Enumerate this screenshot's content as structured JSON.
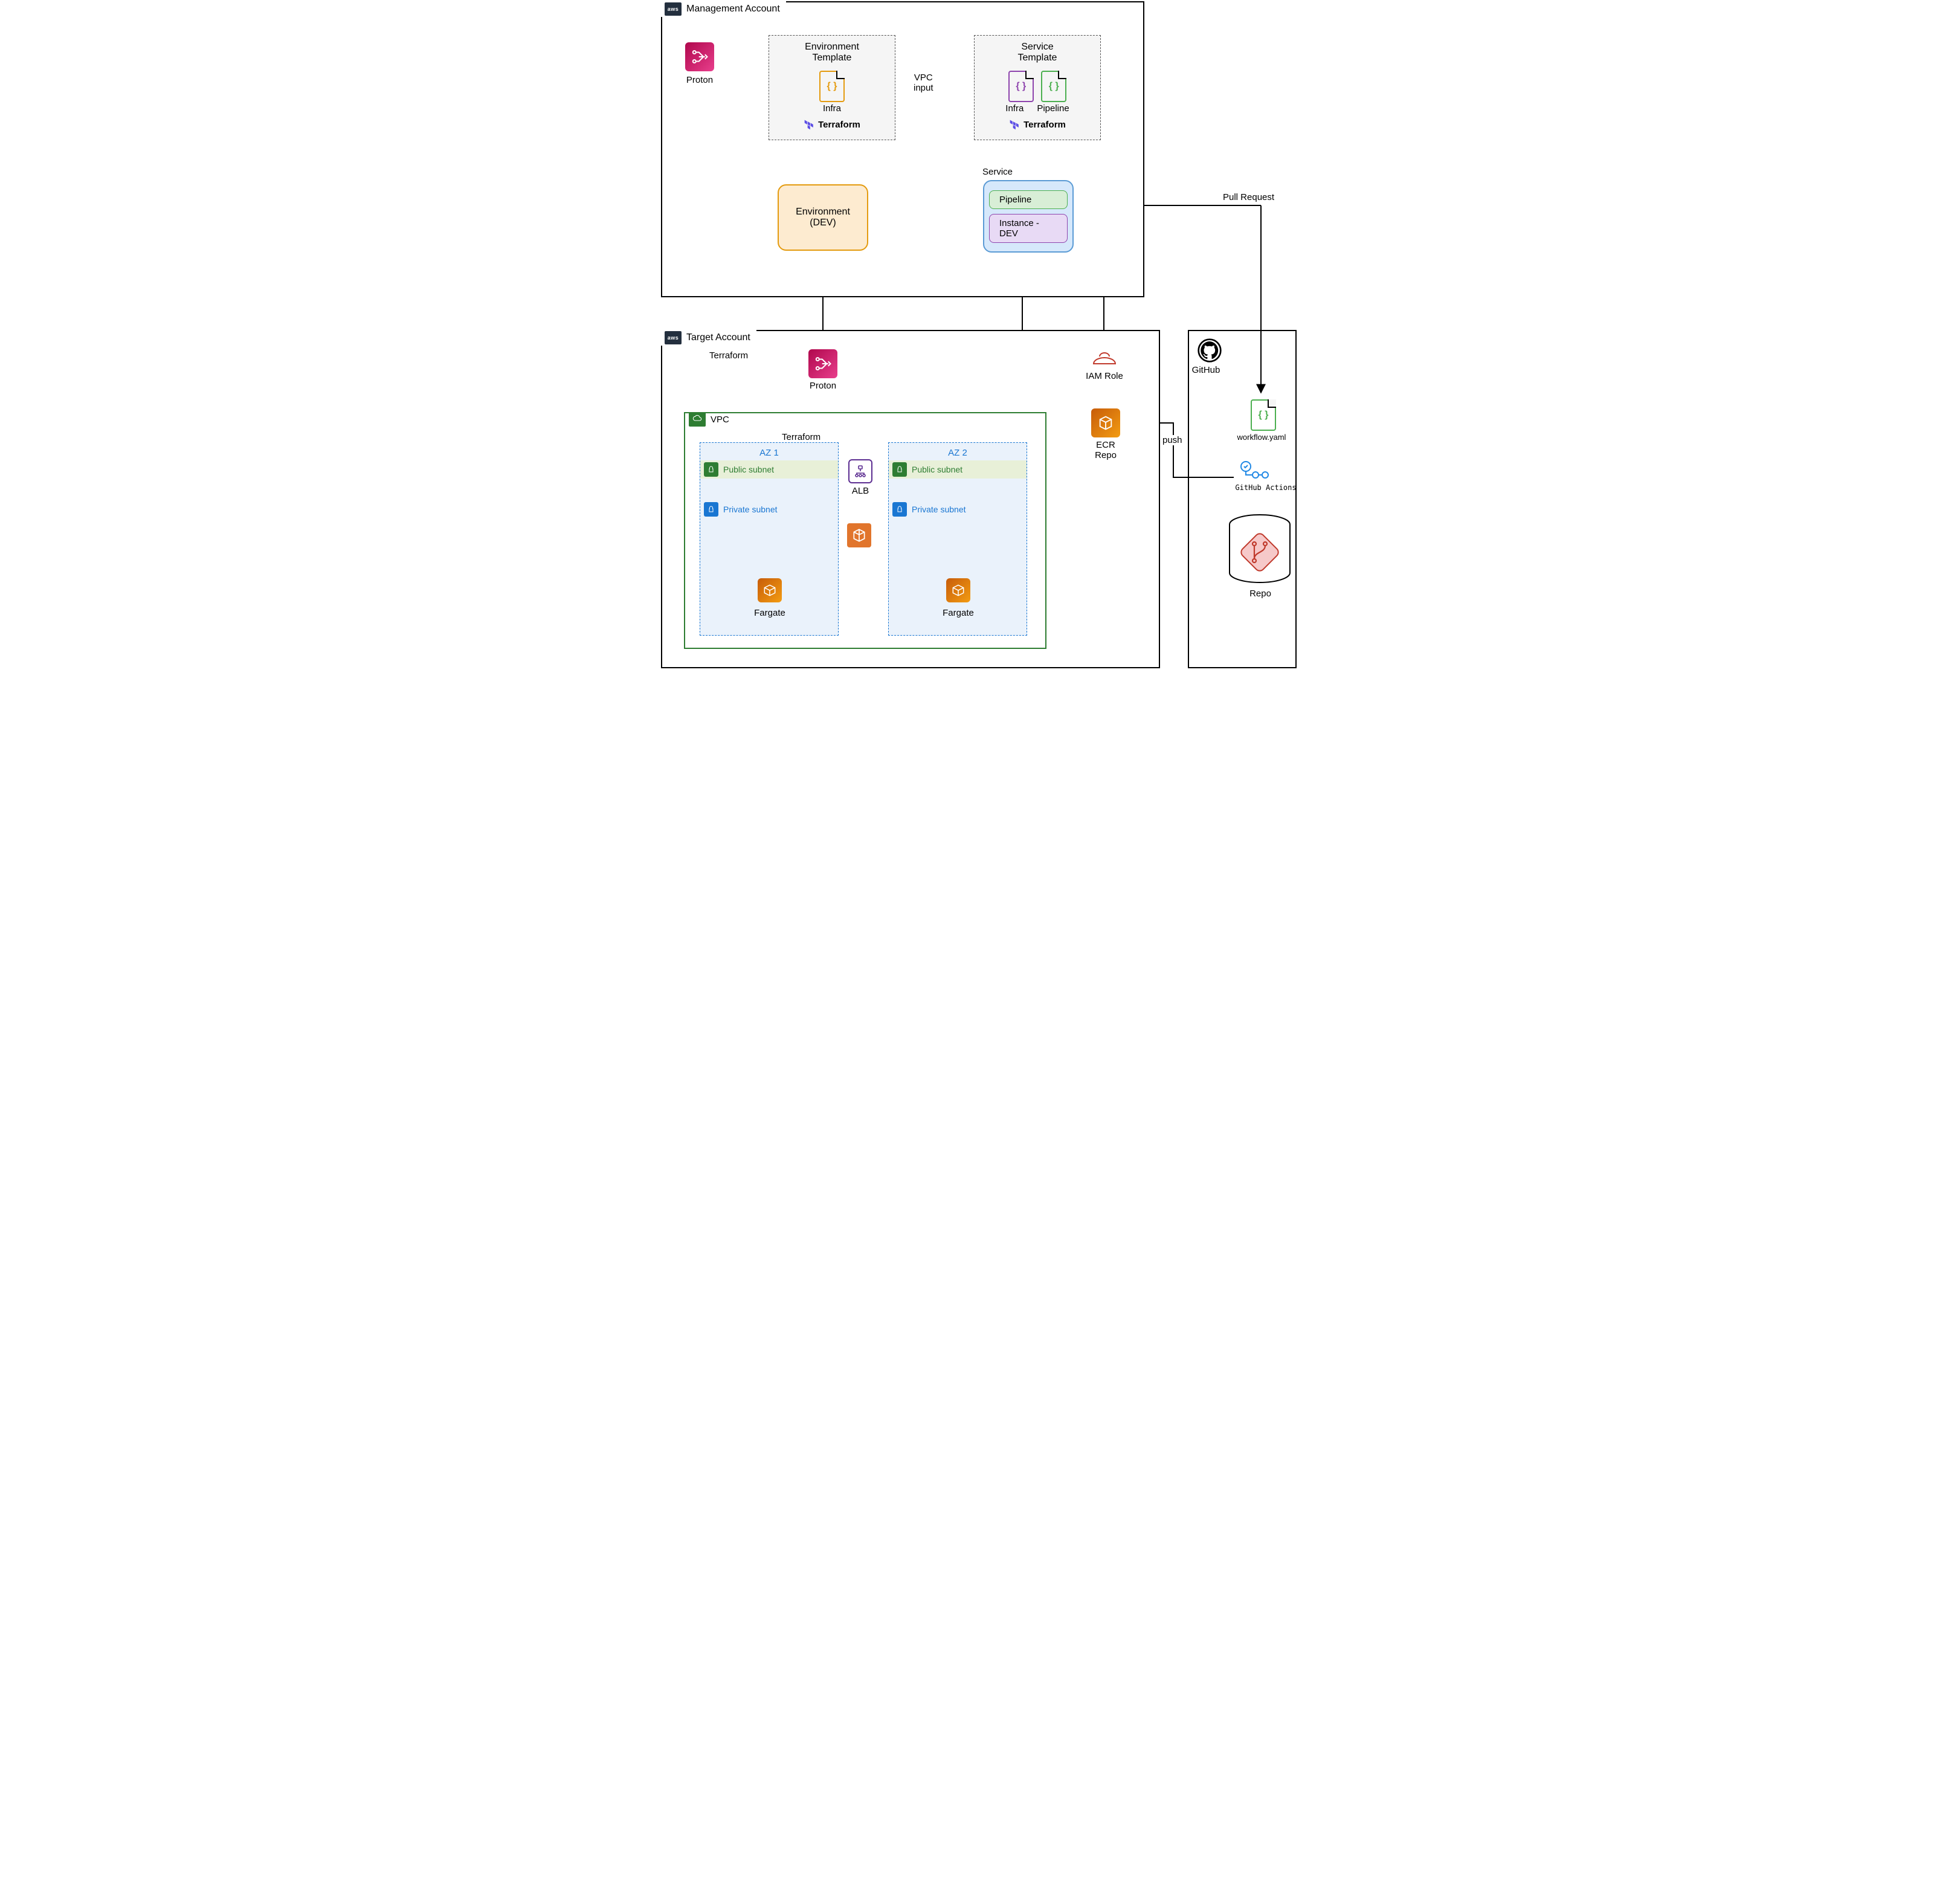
{
  "accounts": {
    "management": {
      "title": "Management Account"
    },
    "target": {
      "title": "Target Account"
    }
  },
  "proton_label": "Proton",
  "env_template": {
    "title": "Environment\nTemplate",
    "doc": "Infra",
    "tool": "Terraform"
  },
  "svc_template": {
    "title": "Service\nTemplate",
    "doc1": "Infra",
    "doc2": "Pipeline",
    "tool": "Terraform"
  },
  "vpc_input": "VPC\ninput",
  "environment": "Environment\n(DEV)",
  "service": {
    "title": "Service",
    "pipeline": "Pipeline",
    "instance": "Instance - DEV"
  },
  "pull_request": "Pull Request",
  "terraform_lbl": "Terraform",
  "vpc_title": "VPC",
  "az1": "AZ 1",
  "az2": "AZ 2",
  "public_subnet": "Public subnet",
  "private_subnet": "Private subnet",
  "alb": "ALB",
  "fargate": "Fargate",
  "iam_role": "IAM Role",
  "ecr_repo": "ECR\nRepo",
  "push": "push",
  "github": "GitHub",
  "workflow": "workflow.yaml",
  "gha": "GitHub Actions",
  "repo": "Repo"
}
